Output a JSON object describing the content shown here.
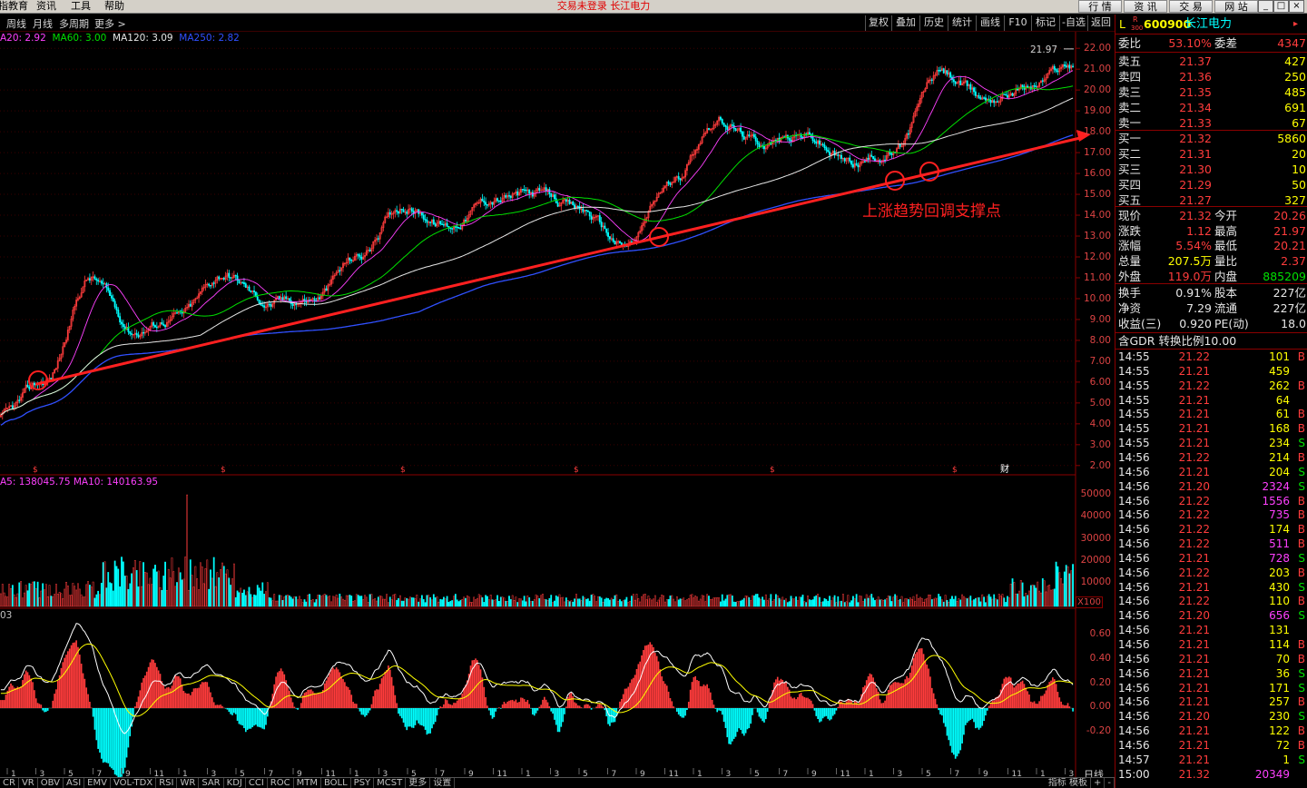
{
  "menu": {
    "items": [
      "指教育",
      "资讯",
      "工具",
      "帮助"
    ],
    "status": "交易未登录  长江电力",
    "right_buttons": [
      "行 情",
      "资 讯",
      "交 易",
      "网 站"
    ]
  },
  "toolbar": {
    "left": [
      "周线",
      "月线",
      "多周期",
      "更多 >"
    ],
    "right": [
      "复权",
      "叠加",
      "历史",
      "统计",
      "画线",
      "F10",
      "标记",
      "-自选",
      "返回"
    ]
  },
  "ma_legend": [
    {
      "text": "A20: 2.92",
      "color": "#ff40ff"
    },
    {
      "text": "MA60: 3.00",
      "color": "#00e000"
    },
    {
      "text": "MA120: 3.09",
      "color": "#e6e6e6"
    },
    {
      "text": "MA250: 2.82",
      "color": "#3050ff"
    }
  ],
  "price_axis": [
    "22.00",
    "21.00",
    "20.00",
    "19.00",
    "18.00",
    "17.00",
    "16.00",
    "15.00",
    "14.00",
    "13.00",
    "12.00",
    "11.00",
    "10.00",
    "9.00",
    "8.00",
    "7.00",
    "6.00",
    "5.00",
    "4.00",
    "3.00",
    "2.00"
  ],
  "high_marker": "21.97",
  "annotation": "上涨趋势回调支撑点",
  "event_markers": [
    "$",
    "$",
    "$",
    "$",
    "$",
    "$",
    "财"
  ],
  "volume_legend": "A5: 138045.75  MA10: 140163.95",
  "volume_axis": [
    "50000",
    "40000",
    "30000",
    "20000",
    "10000"
  ],
  "volume_unit": "X100",
  "indicator_label": "03",
  "indicator_axis": [
    "0.60",
    "0.40",
    "0.20",
    "0.00",
    "-0.20"
  ],
  "time_axis": [
    "1",
    "3",
    "5",
    "7",
    "9",
    "11",
    "1",
    "3",
    "5",
    "7",
    "9",
    "11",
    "1",
    "3",
    "5",
    "7",
    "9",
    "11",
    "1",
    "3",
    "5",
    "7",
    "9",
    "11",
    "1",
    "3",
    "5",
    "7",
    "9",
    "11",
    "1",
    "3",
    "5",
    "7",
    "9",
    "11",
    "1",
    "3"
  ],
  "period_label": "日线",
  "indicator_tabs": [
    "CR",
    "VR",
    "OBV",
    "ASI",
    "EMV",
    "VOL-TDX",
    "RSI",
    "WR",
    "SAR",
    "KDJ",
    "CCI",
    "ROC",
    "MTM",
    "BOLL",
    "PSY",
    "MCST",
    "更多",
    "设置"
  ],
  "indicator_tabs_right": [
    "指标 模板",
    "+",
    "-"
  ],
  "stock": {
    "prefix": "L",
    "board": "R",
    "board_sub": "300",
    "code": "600900",
    "name": "长江电力"
  },
  "weibi": {
    "label": "委比",
    "value": "53.10%",
    "label2": "委差",
    "value2": "4347"
  },
  "sells": [
    {
      "label": "卖五",
      "price": "21.37",
      "vol": "427"
    },
    {
      "label": "卖四",
      "price": "21.36",
      "vol": "250"
    },
    {
      "label": "卖三",
      "price": "21.35",
      "vol": "485"
    },
    {
      "label": "卖二",
      "price": "21.34",
      "vol": "691"
    },
    {
      "label": "卖一",
      "price": "21.33",
      "vol": "67"
    }
  ],
  "buys": [
    {
      "label": "买一",
      "price": "21.32",
      "vol": "5860"
    },
    {
      "label": "买二",
      "price": "21.31",
      "vol": "20"
    },
    {
      "label": "买三",
      "price": "21.30",
      "vol": "10"
    },
    {
      "label": "买四",
      "price": "21.29",
      "vol": "50"
    },
    {
      "label": "买五",
      "price": "21.27",
      "vol": "327"
    }
  ],
  "quote": [
    {
      "l1": "现价",
      "v1": "21.32",
      "c1": "red",
      "l2": "今开",
      "v2": "20.26",
      "c2": "red"
    },
    {
      "l1": "涨跌",
      "v1": "1.12",
      "c1": "red",
      "l2": "最高",
      "v2": "21.97",
      "c2": "red"
    },
    {
      "l1": "涨幅",
      "v1": "5.54%",
      "c1": "red",
      "l2": "最低",
      "v2": "20.21",
      "c2": "red"
    },
    {
      "l1": "总量",
      "v1": "207.5万",
      "c1": "yel",
      "l2": "量比",
      "v2": "2.37",
      "c2": "red"
    },
    {
      "l1": "外盘",
      "v1": "119.0万",
      "c1": "red",
      "l2": "内盘",
      "v2": "885209",
      "c2": "grn"
    }
  ],
  "fin": [
    {
      "l1": "换手",
      "v1": "0.91%",
      "l2": "股本",
      "v2": "227亿"
    },
    {
      "l1": "净资",
      "v1": "7.29",
      "l2": "流通",
      "v2": "227亿"
    },
    {
      "l1": "收益(三)",
      "v1": "0.920",
      "l2": "PE(动)",
      "v2": "18.0"
    }
  ],
  "gdr": "含GDR 转换比例10.00",
  "ticks": [
    {
      "t": "14:55",
      "p": "21.22",
      "v": "101",
      "s": "B"
    },
    {
      "t": "14:55",
      "p": "21.21",
      "v": "459",
      "s": ""
    },
    {
      "t": "14:55",
      "p": "21.22",
      "v": "262",
      "s": "B"
    },
    {
      "t": "14:55",
      "p": "21.21",
      "v": "64",
      "s": ""
    },
    {
      "t": "14:55",
      "p": "21.21",
      "v": "61",
      "s": "B"
    },
    {
      "t": "14:55",
      "p": "21.21",
      "v": "168",
      "s": "B"
    },
    {
      "t": "14:55",
      "p": "21.21",
      "v": "234",
      "s": "S"
    },
    {
      "t": "14:56",
      "p": "21.22",
      "v": "214",
      "s": "B"
    },
    {
      "t": "14:56",
      "p": "21.21",
      "v": "204",
      "s": "S"
    },
    {
      "t": "14:56",
      "p": "21.20",
      "v": "2324",
      "s": "S"
    },
    {
      "t": "14:56",
      "p": "21.22",
      "v": "1556",
      "s": "B"
    },
    {
      "t": "14:56",
      "p": "21.22",
      "v": "735",
      "s": "B"
    },
    {
      "t": "14:56",
      "p": "21.22",
      "v": "174",
      "s": "B"
    },
    {
      "t": "14:56",
      "p": "21.22",
      "v": "511",
      "s": "B"
    },
    {
      "t": "14:56",
      "p": "21.21",
      "v": "728",
      "s": "S"
    },
    {
      "t": "14:56",
      "p": "21.22",
      "v": "203",
      "s": "B"
    },
    {
      "t": "14:56",
      "p": "21.21",
      "v": "430",
      "s": "S"
    },
    {
      "t": "14:56",
      "p": "21.22",
      "v": "110",
      "s": "B"
    },
    {
      "t": "14:56",
      "p": "21.20",
      "v": "656",
      "s": "S"
    },
    {
      "t": "14:56",
      "p": "21.21",
      "v": "131",
      "s": ""
    },
    {
      "t": "14:56",
      "p": "21.21",
      "v": "114",
      "s": "B"
    },
    {
      "t": "14:56",
      "p": "21.21",
      "v": "70",
      "s": "B"
    },
    {
      "t": "14:56",
      "p": "21.21",
      "v": "36",
      "s": "S"
    },
    {
      "t": "14:56",
      "p": "21.21",
      "v": "171",
      "s": "S"
    },
    {
      "t": "14:56",
      "p": "21.21",
      "v": "257",
      "s": "B"
    },
    {
      "t": "14:56",
      "p": "21.20",
      "v": "230",
      "s": "S"
    },
    {
      "t": "14:56",
      "p": "21.21",
      "v": "122",
      "s": "B"
    },
    {
      "t": "14:56",
      "p": "21.21",
      "v": "72",
      "s": "B"
    },
    {
      "t": "14:57",
      "p": "21.21",
      "v": "1",
      "s": "S"
    },
    {
      "t": "15:00",
      "p": "21.32",
      "v": "20349",
      "s": ""
    }
  ],
  "colors": {
    "up": "#ff3c3c",
    "down": "#00ffff",
    "trendline": "#ff2020",
    "border": "#8b0000",
    "ma20": "#ff40ff",
    "ma60": "#00e000",
    "ma120": "#e6e6e6",
    "ma250": "#3050ff"
  },
  "chart_data": {
    "type": "line",
    "title": "",
    "series": [
      {
        "name": "",
        "values": [
          4.3,
          6.0,
          11.0,
          8.5,
          9.2,
          11.2,
          9.8,
          10.0,
          12.0,
          14.5,
          13.5,
          14.8,
          15.0,
          14.2,
          12.5,
          15.5,
          18.6,
          17.5,
          17.8,
          16.5,
          17.0,
          20.8,
          19.6,
          20.2,
          21.3
        ]
      }
    ],
    "trendline": {
      "from": 5.9,
      "to": 17.7
    },
    "ylim": [
      1.5,
      22.6
    ]
  }
}
